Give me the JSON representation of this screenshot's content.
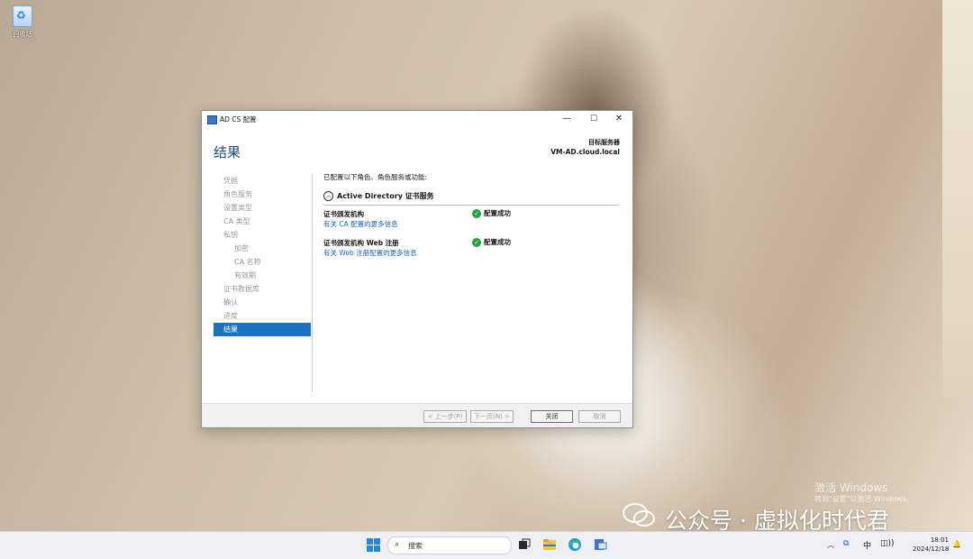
{
  "desktop": {
    "recycle_bin_label": "回收站",
    "activation_title": "激活 Windows",
    "activation_sub": "转到\"设置\"以激活 Windows。",
    "wechat_watermark": "公众号 · 虚拟化时代君"
  },
  "window": {
    "title": "AD CS 配置",
    "heading": "结果",
    "target_label": "目标服务器",
    "target_value": "VM-AD.cloud.local",
    "nav": [
      {
        "label": "凭据"
      },
      {
        "label": "角色服务"
      },
      {
        "label": "设置类型"
      },
      {
        "label": "CA 类型"
      },
      {
        "label": "私钥"
      },
      {
        "label": "加密"
      },
      {
        "label": "CA 名称"
      },
      {
        "label": "有效期"
      },
      {
        "label": "证书数据库"
      },
      {
        "label": "确认"
      },
      {
        "label": "进度"
      },
      {
        "label": "结果"
      }
    ],
    "intro": "已配置以下角色、角色服务或功能:",
    "service_title": "Active Directory 证书服务",
    "roles": [
      {
        "name": "证书颁发机构",
        "link": "有关 CA 配置的更多信息",
        "status": "配置成功"
      },
      {
        "name": "证书颁发机构 Web 注册",
        "link": "有关 Web 注册配置的更多信息",
        "status": "配置成功"
      }
    ],
    "buttons": {
      "prev": "< 上一步(P)",
      "next": "下一页(N) >",
      "close": "关闭",
      "cancel": "取消"
    }
  },
  "taskbar": {
    "search_placeholder": "搜索",
    "lang": "中",
    "time": "18:01",
    "date": "2024/12/18"
  }
}
